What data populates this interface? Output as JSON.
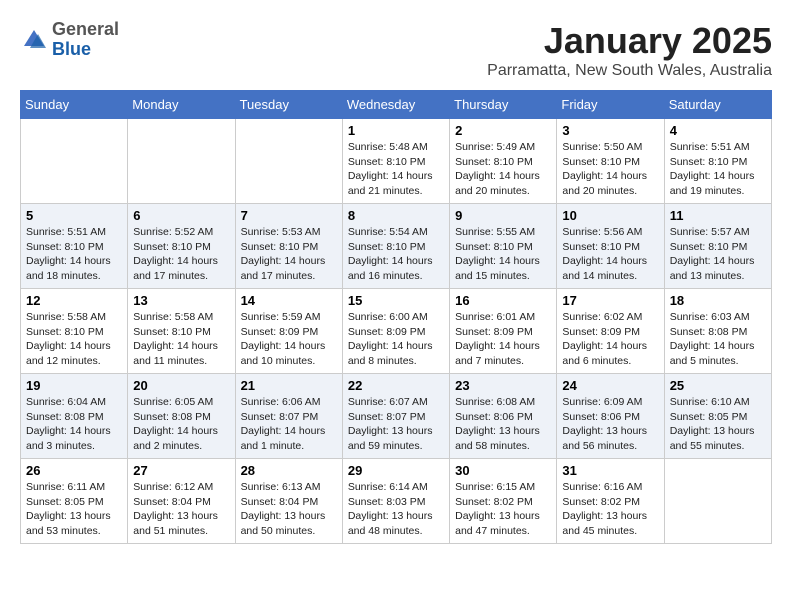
{
  "header": {
    "logo_general": "General",
    "logo_blue": "Blue",
    "month_title": "January 2025",
    "subtitle": "Parramatta, New South Wales, Australia"
  },
  "weekdays": [
    "Sunday",
    "Monday",
    "Tuesday",
    "Wednesday",
    "Thursday",
    "Friday",
    "Saturday"
  ],
  "weeks": [
    [
      {
        "day": "",
        "info": ""
      },
      {
        "day": "",
        "info": ""
      },
      {
        "day": "",
        "info": ""
      },
      {
        "day": "1",
        "info": "Sunrise: 5:48 AM\nSunset: 8:10 PM\nDaylight: 14 hours\nand 21 minutes."
      },
      {
        "day": "2",
        "info": "Sunrise: 5:49 AM\nSunset: 8:10 PM\nDaylight: 14 hours\nand 20 minutes."
      },
      {
        "day": "3",
        "info": "Sunrise: 5:50 AM\nSunset: 8:10 PM\nDaylight: 14 hours\nand 20 minutes."
      },
      {
        "day": "4",
        "info": "Sunrise: 5:51 AM\nSunset: 8:10 PM\nDaylight: 14 hours\nand 19 minutes."
      }
    ],
    [
      {
        "day": "5",
        "info": "Sunrise: 5:51 AM\nSunset: 8:10 PM\nDaylight: 14 hours\nand 18 minutes."
      },
      {
        "day": "6",
        "info": "Sunrise: 5:52 AM\nSunset: 8:10 PM\nDaylight: 14 hours\nand 17 minutes."
      },
      {
        "day": "7",
        "info": "Sunrise: 5:53 AM\nSunset: 8:10 PM\nDaylight: 14 hours\nand 17 minutes."
      },
      {
        "day": "8",
        "info": "Sunrise: 5:54 AM\nSunset: 8:10 PM\nDaylight: 14 hours\nand 16 minutes."
      },
      {
        "day": "9",
        "info": "Sunrise: 5:55 AM\nSunset: 8:10 PM\nDaylight: 14 hours\nand 15 minutes."
      },
      {
        "day": "10",
        "info": "Sunrise: 5:56 AM\nSunset: 8:10 PM\nDaylight: 14 hours\nand 14 minutes."
      },
      {
        "day": "11",
        "info": "Sunrise: 5:57 AM\nSunset: 8:10 PM\nDaylight: 14 hours\nand 13 minutes."
      }
    ],
    [
      {
        "day": "12",
        "info": "Sunrise: 5:58 AM\nSunset: 8:10 PM\nDaylight: 14 hours\nand 12 minutes."
      },
      {
        "day": "13",
        "info": "Sunrise: 5:58 AM\nSunset: 8:10 PM\nDaylight: 14 hours\nand 11 minutes."
      },
      {
        "day": "14",
        "info": "Sunrise: 5:59 AM\nSunset: 8:09 PM\nDaylight: 14 hours\nand 10 minutes."
      },
      {
        "day": "15",
        "info": "Sunrise: 6:00 AM\nSunset: 8:09 PM\nDaylight: 14 hours\nand 8 minutes."
      },
      {
        "day": "16",
        "info": "Sunrise: 6:01 AM\nSunset: 8:09 PM\nDaylight: 14 hours\nand 7 minutes."
      },
      {
        "day": "17",
        "info": "Sunrise: 6:02 AM\nSunset: 8:09 PM\nDaylight: 14 hours\nand 6 minutes."
      },
      {
        "day": "18",
        "info": "Sunrise: 6:03 AM\nSunset: 8:08 PM\nDaylight: 14 hours\nand 5 minutes."
      }
    ],
    [
      {
        "day": "19",
        "info": "Sunrise: 6:04 AM\nSunset: 8:08 PM\nDaylight: 14 hours\nand 3 minutes."
      },
      {
        "day": "20",
        "info": "Sunrise: 6:05 AM\nSunset: 8:08 PM\nDaylight: 14 hours\nand 2 minutes."
      },
      {
        "day": "21",
        "info": "Sunrise: 6:06 AM\nSunset: 8:07 PM\nDaylight: 14 hours\nand 1 minute."
      },
      {
        "day": "22",
        "info": "Sunrise: 6:07 AM\nSunset: 8:07 PM\nDaylight: 13 hours\nand 59 minutes."
      },
      {
        "day": "23",
        "info": "Sunrise: 6:08 AM\nSunset: 8:06 PM\nDaylight: 13 hours\nand 58 minutes."
      },
      {
        "day": "24",
        "info": "Sunrise: 6:09 AM\nSunset: 8:06 PM\nDaylight: 13 hours\nand 56 minutes."
      },
      {
        "day": "25",
        "info": "Sunrise: 6:10 AM\nSunset: 8:05 PM\nDaylight: 13 hours\nand 55 minutes."
      }
    ],
    [
      {
        "day": "26",
        "info": "Sunrise: 6:11 AM\nSunset: 8:05 PM\nDaylight: 13 hours\nand 53 minutes."
      },
      {
        "day": "27",
        "info": "Sunrise: 6:12 AM\nSunset: 8:04 PM\nDaylight: 13 hours\nand 51 minutes."
      },
      {
        "day": "28",
        "info": "Sunrise: 6:13 AM\nSunset: 8:04 PM\nDaylight: 13 hours\nand 50 minutes."
      },
      {
        "day": "29",
        "info": "Sunrise: 6:14 AM\nSunset: 8:03 PM\nDaylight: 13 hours\nand 48 minutes."
      },
      {
        "day": "30",
        "info": "Sunrise: 6:15 AM\nSunset: 8:02 PM\nDaylight: 13 hours\nand 47 minutes."
      },
      {
        "day": "31",
        "info": "Sunrise: 6:16 AM\nSunset: 8:02 PM\nDaylight: 13 hours\nand 45 minutes."
      },
      {
        "day": "",
        "info": ""
      }
    ]
  ]
}
